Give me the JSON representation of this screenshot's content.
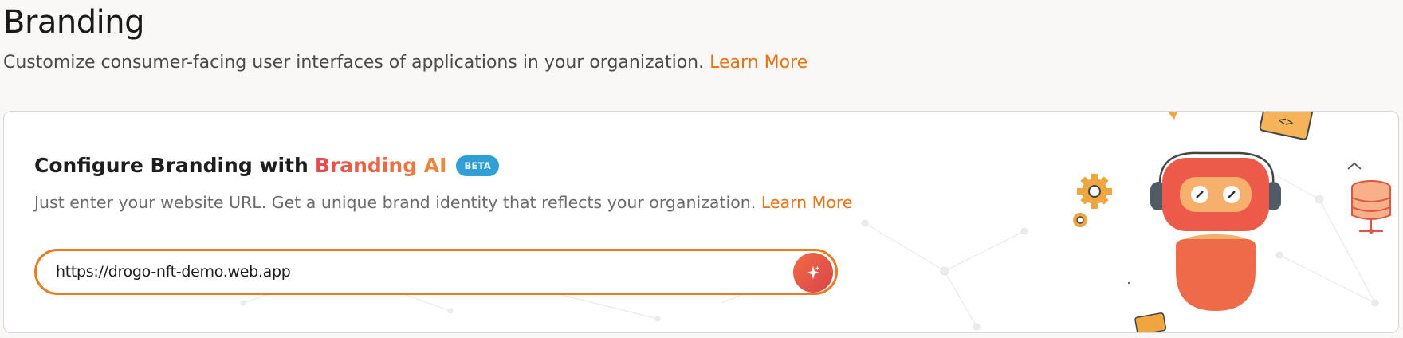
{
  "header": {
    "title": "Branding",
    "subtitle": "Customize consumer-facing user interfaces of applications in your organization.",
    "learn_more": "Learn More"
  },
  "card": {
    "title_prefix": "Configure Branding with",
    "title_accent": "Branding AI",
    "badge": "BETA",
    "description": "Just enter your website URL. Get a unique brand identity that reflects your organization.",
    "learn_more": "Learn More",
    "url_input_value": "https://drogo-nft-demo.web.app"
  },
  "icons": {
    "ai_button": "sparkle-icon",
    "collapse": "chevron-up-icon",
    "robot": "robot-illustration",
    "gears": "gear-icon",
    "database": "database-icon",
    "code": "code-icon"
  },
  "colors": {
    "accent": "#e77314",
    "badge": "#2f9fd6",
    "ai_gradient_start": "#e6484c",
    "ai_gradient_end": "#f08a3a"
  }
}
